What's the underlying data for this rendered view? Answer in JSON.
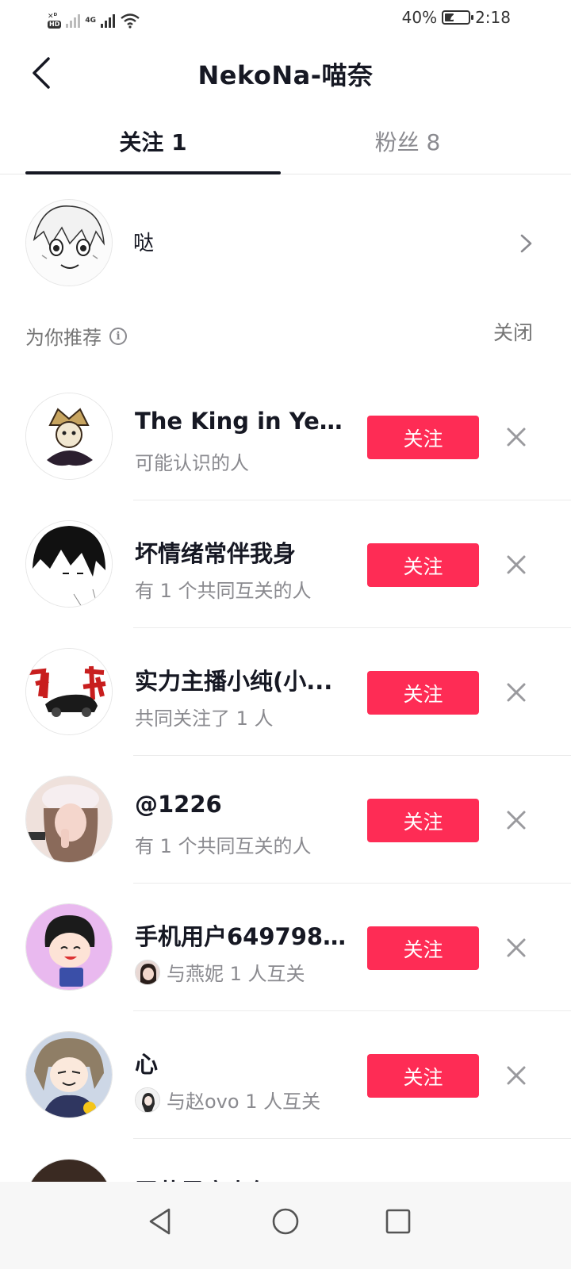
{
  "status_bar": {
    "hd": "HD",
    "network": "4G",
    "battery_text": "40%",
    "battery_level": 0.4,
    "time": "2:18"
  },
  "header": {
    "title": "NekoNa-喵奈"
  },
  "tabs": [
    {
      "label": "关注 1",
      "active": true
    },
    {
      "label": "粉丝 8",
      "active": false
    }
  ],
  "following": {
    "name": "哒"
  },
  "recommend": {
    "title": "为你推荐",
    "close_label": "关闭",
    "follow_label": "关注",
    "items": [
      {
        "name": "The King in Yellow",
        "subtitle": "可能认识的人",
        "mutual_avatar": false,
        "avatar_color": "#c8a560"
      },
      {
        "name": "坏情绪常伴我身",
        "subtitle": "有 1 个共同互关的人",
        "mutual_avatar": false,
        "avatar_color": "#111111"
      },
      {
        "name": "实力主播小纯(小...",
        "subtitle": "共同关注了 1 人",
        "mutual_avatar": false,
        "avatar_color": "#c81e1e"
      },
      {
        "name": "@1226",
        "subtitle": "有 1 个共同互关的人",
        "mutual_avatar": false,
        "avatar_color": "#e8c6c0"
      },
      {
        "name": "手机用户649798...",
        "subtitle": "与燕妮 1 人互关",
        "mutual_avatar": true,
        "avatar_color": "#e9b9ef"
      },
      {
        "name": "心",
        "subtitle": "与赵ovo 1 人互关",
        "mutual_avatar": true,
        "avatar_color": "#8f7e66"
      },
      {
        "name": "罗莽里腐少年",
        "subtitle": "",
        "mutual_avatar": false,
        "avatar_color": "#3a2a22"
      }
    ]
  },
  "colors": {
    "accent": "#fe2c55",
    "text_primary": "#161823",
    "text_secondary": "#8a8a8f"
  }
}
